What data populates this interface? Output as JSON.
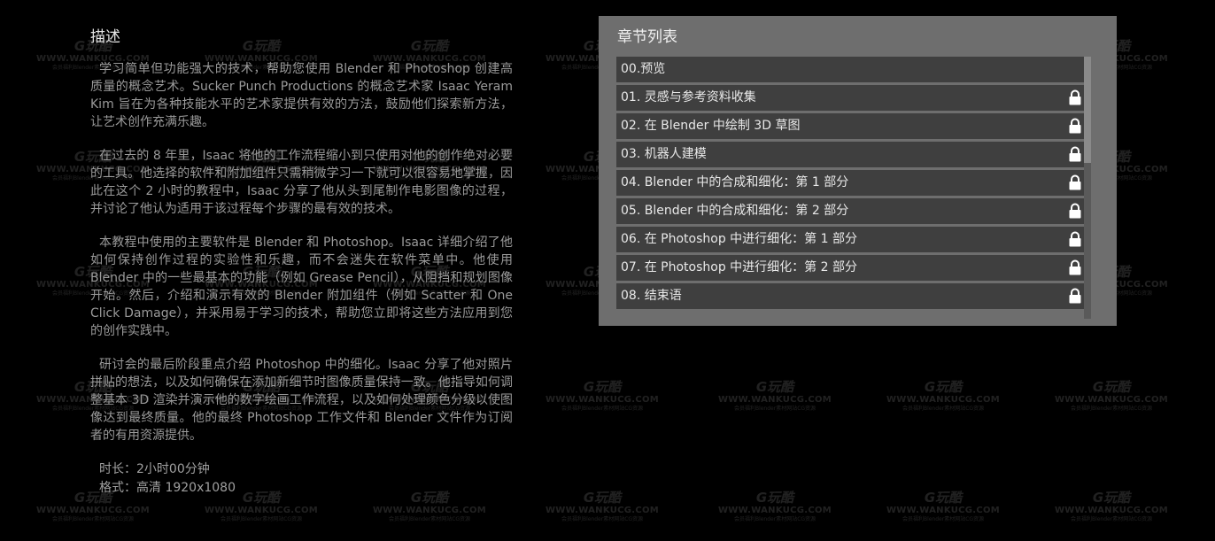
{
  "watermark": {
    "logo": "G玩酷",
    "url": "WWW.WANKUCG.COM",
    "tag": "会员福利Blender素材网站CG资源"
  },
  "description": {
    "title": "描述",
    "paragraphs": [
      "学习简单但功能强大的技术，帮助您使用 Blender 和 Photoshop 创建高质量的概念艺术。Sucker Punch Productions 的概念艺术家 Isaac Yeram Kim 旨在为各种技能水平的艺术家提供有效的方法，鼓励他们探索新方法，让艺术创作充满乐趣。",
      "在过去的 8 年里，Isaac 将他的工作流程缩小到只使用对他的创作绝对必要的工具。他选择的软件和附加组件只需稍微学习一下就可以很容易地掌握，因此在这个 2 小时的教程中，Isaac 分享了他从头到尾制作电影图像的过程，并讨论了他认为适用于该过程每个步骤的最有效的技术。",
      "本教程中使用的主要软件是 Blender 和 Photoshop。Isaac 详细介绍了他如何保持创作过程的实验性和乐趣，而不会迷失在软件菜单中。他使用 Blender 中的一些最基本的功能（例如 Grease Pencil），从阻挡和规划图像开始。然后，介绍和演示有效的 Blender 附加组件（例如 Scatter 和 One Click Damage），并采用易于学习的技术，帮助您立即将这些方法应用到您的创作实践中。",
      "研讨会的最后阶段重点介绍 Photoshop 中的细化。Isaac 分享了他对照片拼贴的想法，以及如何确保在添加新细节时图像质量保持一致。他指导如何调整基本 3D 渲染并演示他的数字绘画工作流程，以及如何处理颜色分级以使图像达到最终质量。他的最终 Photoshop 工作文件和 Blender 文件作为订阅者的有用资源提供。"
    ],
    "duration": "时长：2小时00分钟",
    "format": "格式：高清 1920x1080"
  },
  "chapters": {
    "title": "章节列表",
    "items": [
      {
        "label": "00.预览",
        "locked": false
      },
      {
        "label": "01. 灵感与参考资料收集",
        "locked": true
      },
      {
        "label": "02. 在 Blender 中绘制 3D 草图",
        "locked": true
      },
      {
        "label": "03. 机器人建模",
        "locked": true
      },
      {
        "label": "04. Blender 中的合成和细化：第 1 部分",
        "locked": true
      },
      {
        "label": "05. Blender 中的合成和细化：第 2 部分",
        "locked": true
      },
      {
        "label": "06. 在 Photoshop 中进行细化：第 1 部分",
        "locked": true
      },
      {
        "label": "07. 在 Photoshop 中进行细化：第 2 部分",
        "locked": true
      },
      {
        "label": "08. 结束语",
        "locked": true
      }
    ]
  },
  "colors": {
    "background": "#000000",
    "panel": "#6e6e6e",
    "item": "#3f3f3f",
    "lock": "#ffffff"
  }
}
